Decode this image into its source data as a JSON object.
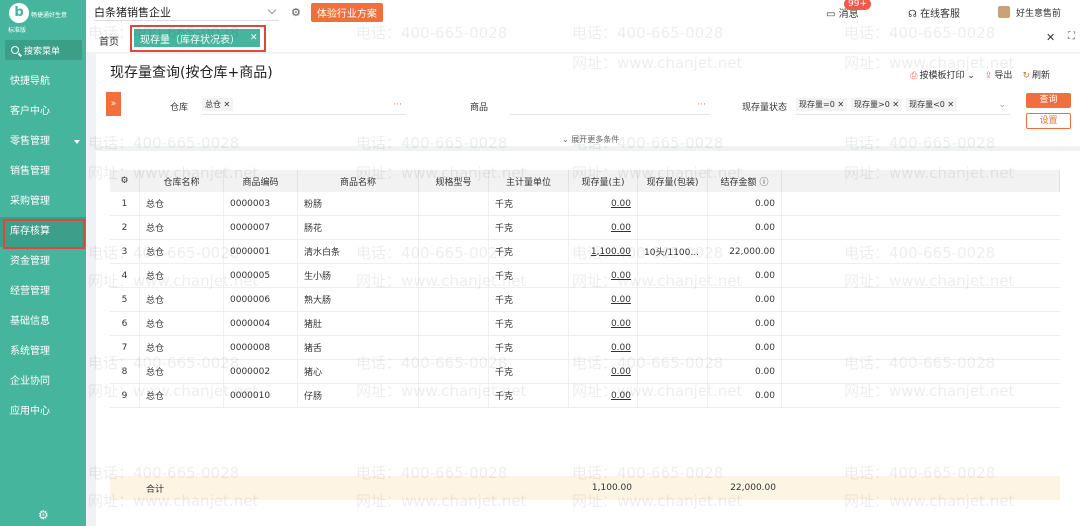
{
  "sidebar": {
    "logo_name": "畅捷通好生意",
    "edition": "标准版",
    "search_label": "搜索菜单",
    "items": [
      {
        "label": "快捷导航",
        "caret": false,
        "active": false
      },
      {
        "label": "客户中心",
        "caret": false,
        "active": false
      },
      {
        "label": "零售管理",
        "caret": true,
        "active": false
      },
      {
        "label": "销售管理",
        "caret": false,
        "active": false
      },
      {
        "label": "采购管理",
        "caret": false,
        "active": false
      },
      {
        "label": "库存核算",
        "caret": false,
        "active": true
      },
      {
        "label": "资金管理",
        "caret": false,
        "active": false
      },
      {
        "label": "经营管理",
        "caret": false,
        "active": false
      },
      {
        "label": "基础信息",
        "caret": false,
        "active": false
      },
      {
        "label": "系统管理",
        "caret": false,
        "active": false
      },
      {
        "label": "企业协同",
        "caret": false,
        "active": false
      },
      {
        "label": "应用中心",
        "caret": false,
        "active": false
      }
    ]
  },
  "topbar": {
    "company": "白条猪销售企业",
    "trial_button": "体验行业方案",
    "message_label": "消息",
    "message_badge": "99+",
    "service_label": "在线客服",
    "user_name": "好生意售前"
  },
  "tabs": {
    "home": "首页",
    "active": "现存量（库存状况表）"
  },
  "page": {
    "title": "现存量查询(按仓库+商品)",
    "actions": {
      "print": "按模板打印",
      "export": "导出",
      "refresh": "刷新"
    },
    "filters": {
      "warehouse_label": "仓库",
      "warehouse_tag": "总仓",
      "product_label": "商品",
      "status_label": "现存量状态",
      "status_tags": [
        "现存量=0",
        "现存量>0",
        "现存量<0"
      ],
      "query_button": "查询",
      "settings_button": "设置",
      "more_conditions": "展开更多条件"
    }
  },
  "table": {
    "headers": [
      "仓库名称",
      "商品编码",
      "商品名称",
      "规格型号",
      "主计量单位",
      "现存量(主)",
      "现存量(包装)",
      "结存金额"
    ],
    "rows": [
      {
        "idx": "1",
        "wh": "总仓",
        "code": "0000003",
        "name": "粉肠",
        "spec": "",
        "unit": "千克",
        "qty": "0.00",
        "pack": "",
        "amt": "0.00"
      },
      {
        "idx": "2",
        "wh": "总仓",
        "code": "0000007",
        "name": "肠花",
        "spec": "",
        "unit": "千克",
        "qty": "0.00",
        "pack": "",
        "amt": "0.00"
      },
      {
        "idx": "3",
        "wh": "总仓",
        "code": "0000001",
        "name": "清水白条",
        "spec": "",
        "unit": "千克",
        "qty": "1,100.00",
        "pack": "10头/1100...",
        "amt": "22,000.00"
      },
      {
        "idx": "4",
        "wh": "总仓",
        "code": "0000005",
        "name": "生小肠",
        "spec": "",
        "unit": "千克",
        "qty": "0.00",
        "pack": "",
        "amt": "0.00"
      },
      {
        "idx": "5",
        "wh": "总仓",
        "code": "0000006",
        "name": "熟大肠",
        "spec": "",
        "unit": "千克",
        "qty": "0.00",
        "pack": "",
        "amt": "0.00"
      },
      {
        "idx": "6",
        "wh": "总仓",
        "code": "0000004",
        "name": "猪肚",
        "spec": "",
        "unit": "千克",
        "qty": "0.00",
        "pack": "",
        "amt": "0.00"
      },
      {
        "idx": "7",
        "wh": "总仓",
        "code": "0000008",
        "name": "猪舌",
        "spec": "",
        "unit": "千克",
        "qty": "0.00",
        "pack": "",
        "amt": "0.00"
      },
      {
        "idx": "8",
        "wh": "总仓",
        "code": "0000002",
        "name": "猪心",
        "spec": "",
        "unit": "千克",
        "qty": "0.00",
        "pack": "",
        "amt": "0.00"
      },
      {
        "idx": "9",
        "wh": "总仓",
        "code": "0000010",
        "name": "仔肠",
        "spec": "",
        "unit": "千克",
        "qty": "0.00",
        "pack": "",
        "amt": "0.00"
      }
    ],
    "totals": {
      "label": "合计",
      "qty": "1,100.00",
      "amt": "22,000.00"
    }
  },
  "watermark": {
    "phone": "电话：400-665-0028",
    "site": "网址：www.chanjet.net"
  },
  "colors": {
    "brand": "#45b59d",
    "accent": "#f06f3c",
    "highlight": "#d94a3a"
  }
}
